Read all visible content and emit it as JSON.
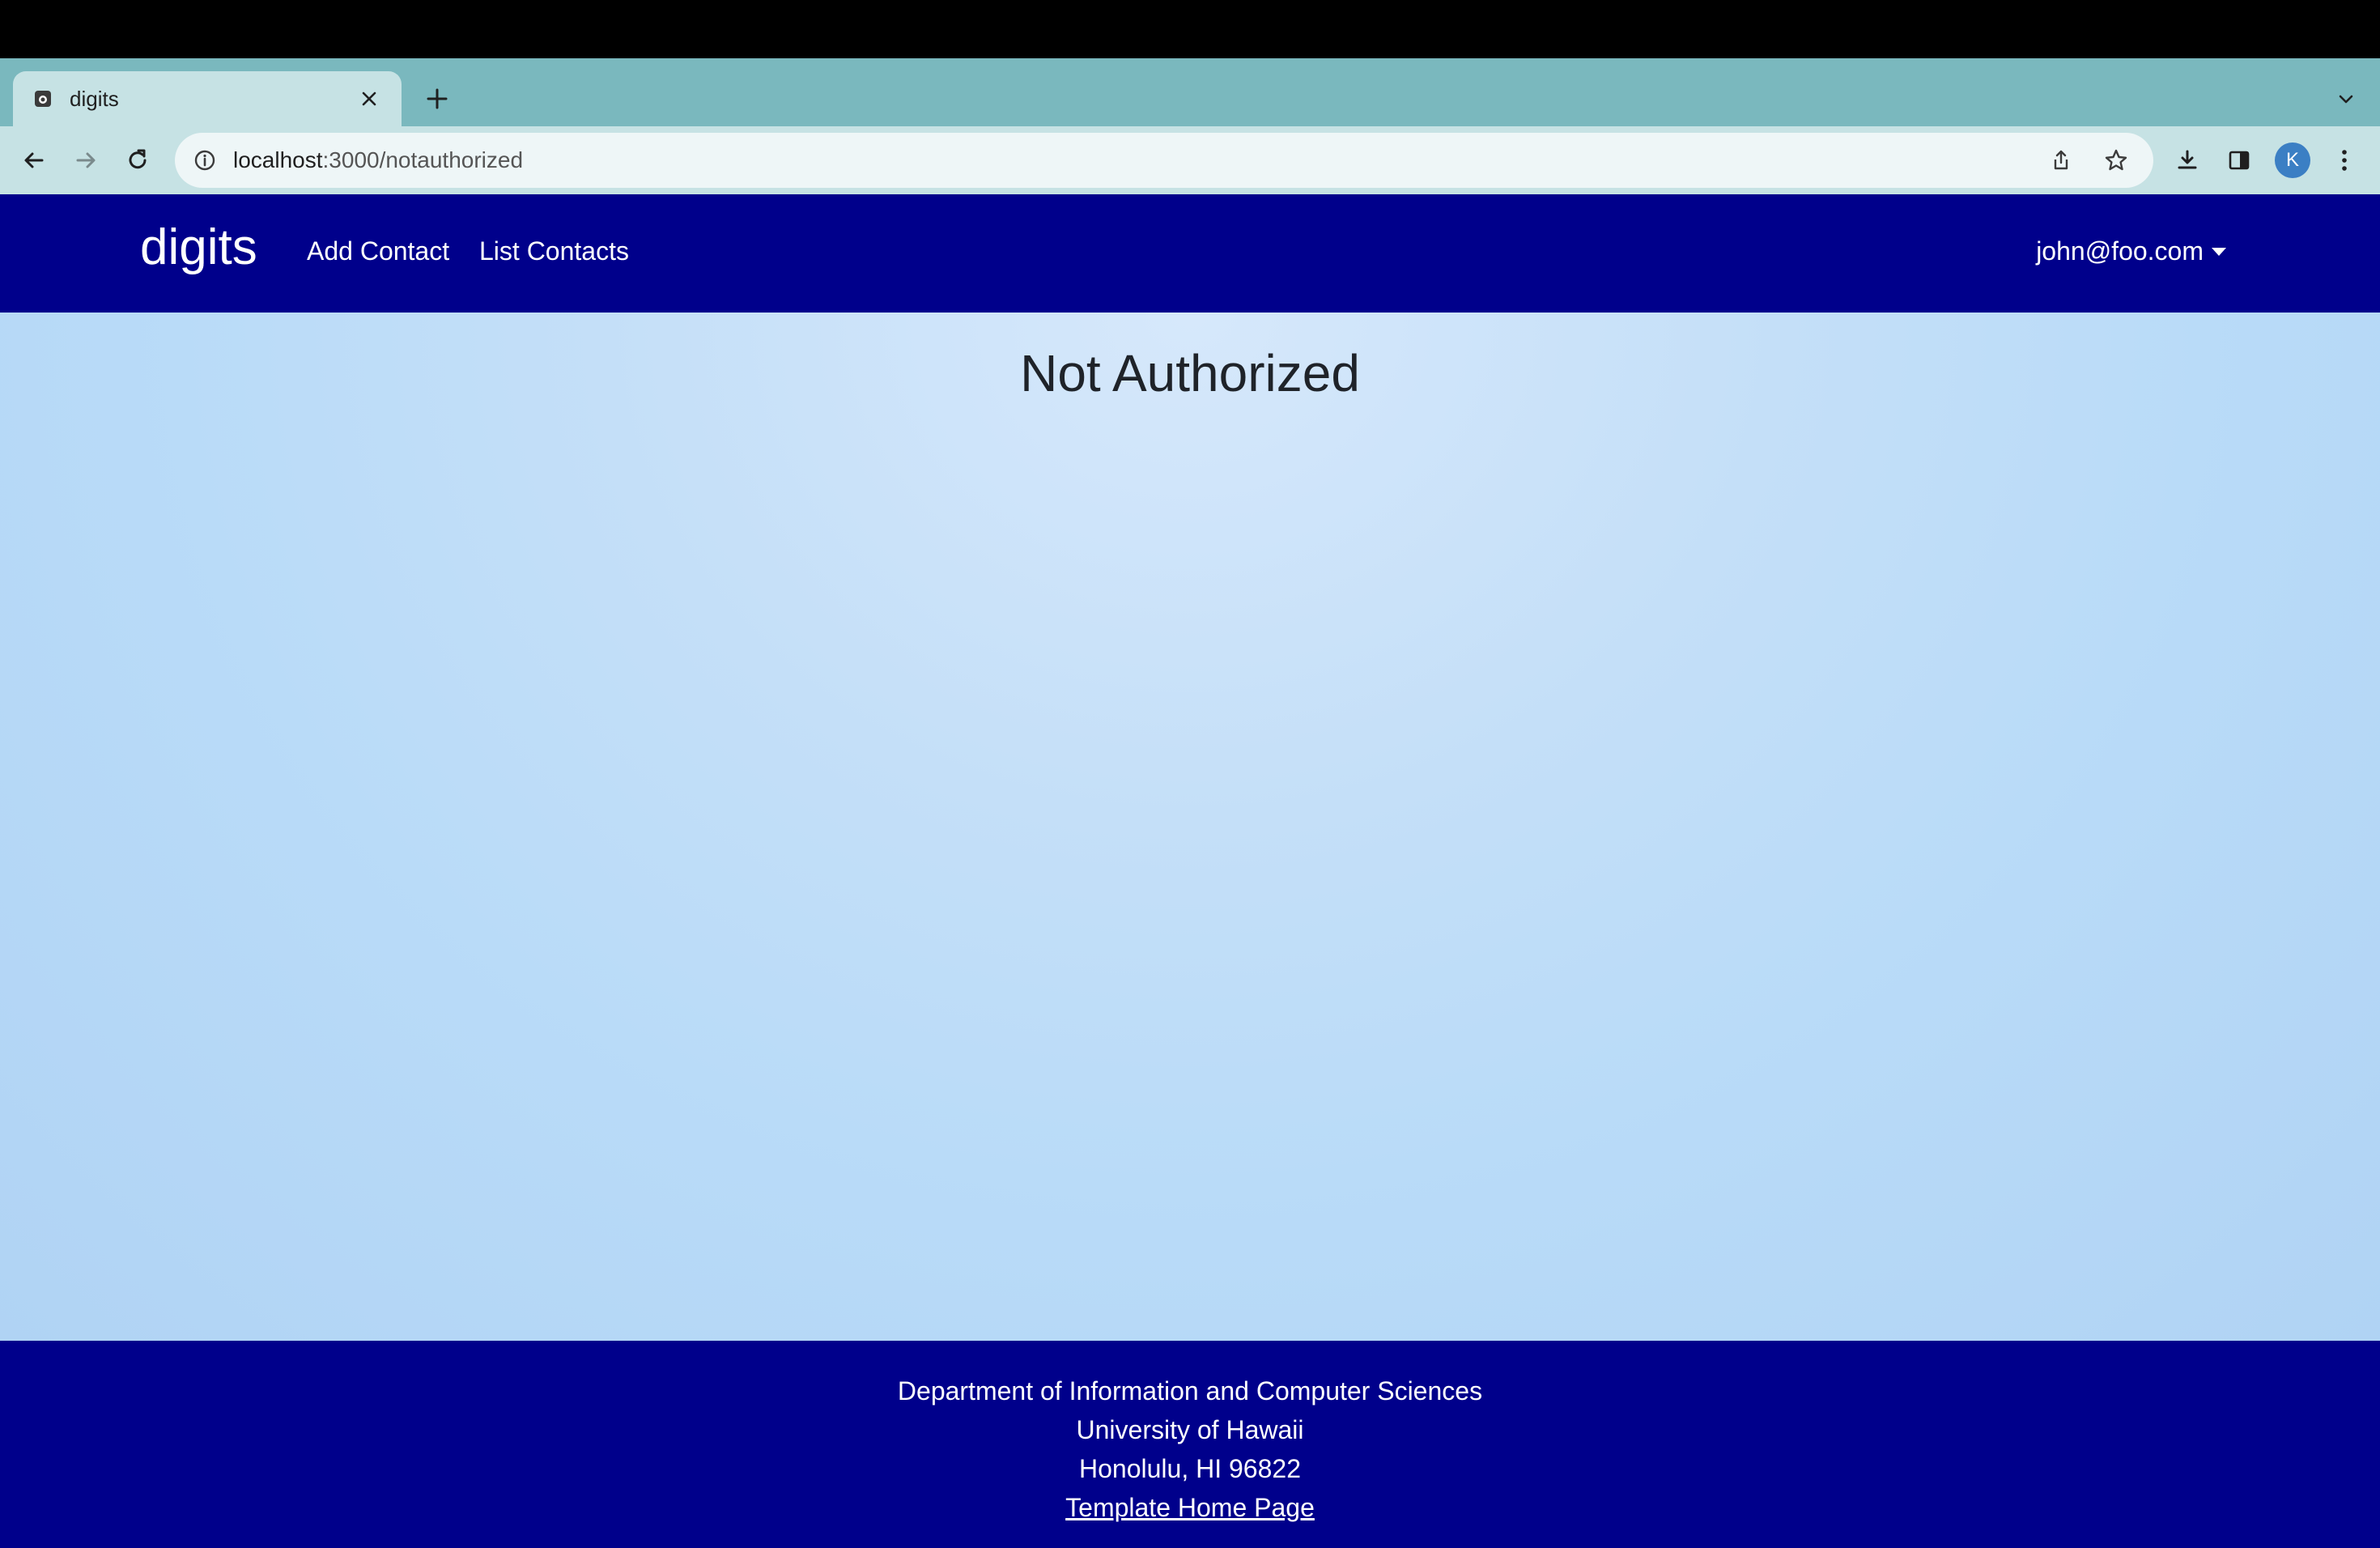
{
  "browser": {
    "tab_title": "digits",
    "url_host": "localhost",
    "url_path": ":3000/notauthorized",
    "profile_initial": "K"
  },
  "navbar": {
    "brand": "digits",
    "links": [
      "Add Contact",
      "List Contacts"
    ],
    "user": "john@foo.com"
  },
  "main": {
    "title": "Not Authorized"
  },
  "footer": {
    "lines": [
      "Department of Information and Computer Sciences",
      "University of Hawaii",
      "Honolulu, HI 96822"
    ],
    "link_text": "Template Home Page"
  },
  "colors": {
    "navbar_bg": "#00008b",
    "tabstrip_bg": "#7ab8be",
    "toolbar_bg": "#c6e2e4",
    "main_bg": "#c4dff8"
  },
  "icons": [
    "favicon-icon",
    "close-icon",
    "plus-icon",
    "chevron-down-icon",
    "back-icon",
    "forward-icon",
    "reload-icon",
    "info-icon",
    "share-icon",
    "star-icon",
    "download-icon",
    "sidepanel-icon",
    "kebab-menu-icon"
  ]
}
